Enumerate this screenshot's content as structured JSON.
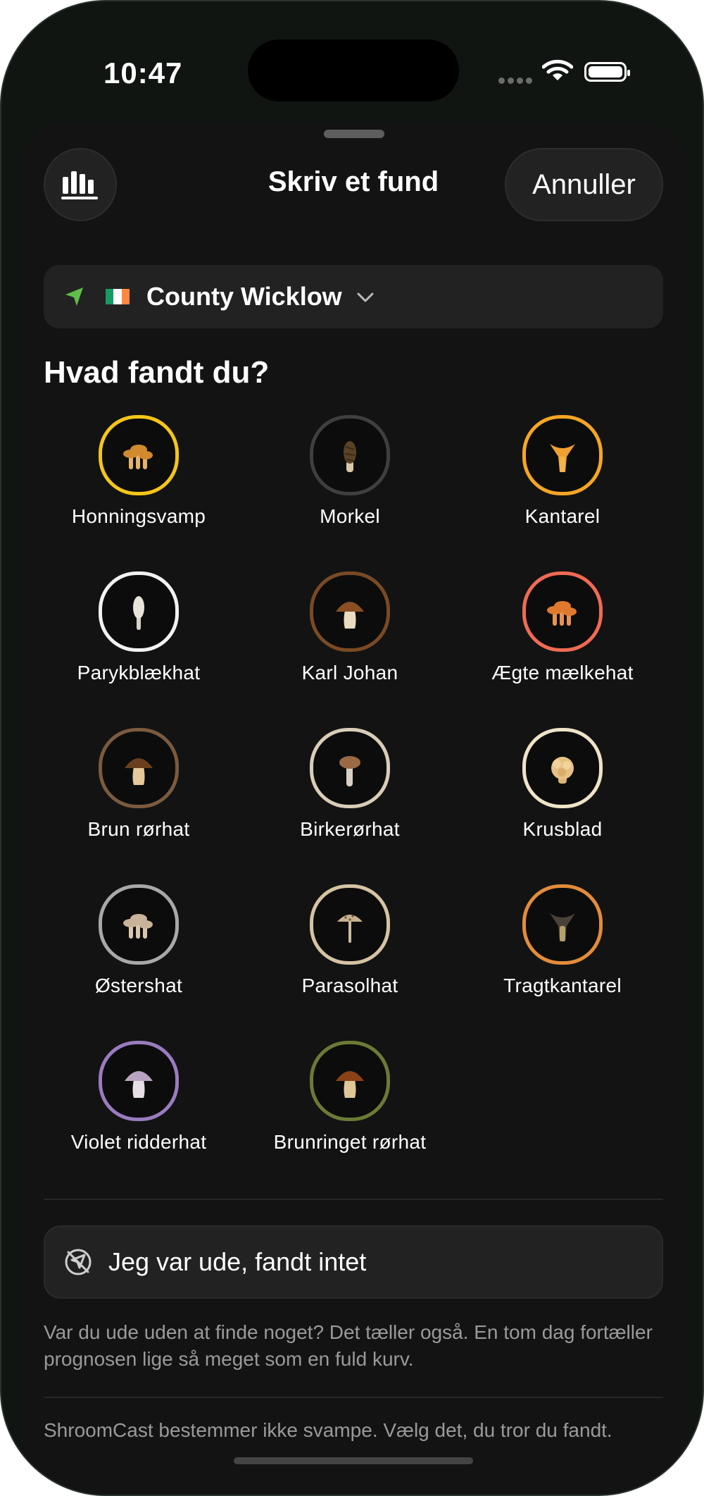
{
  "status_bar": {
    "time": "10:47"
  },
  "header": {
    "title": "Skriv et fund",
    "cancel_label": "Annuller",
    "stats_icon": "bar-chart-icon"
  },
  "location": {
    "name": "County Wicklow",
    "flag_colors": [
      "#169b62",
      "#ffffff",
      "#ff883e"
    ],
    "icon": "location-arrow-icon",
    "accent": "#5fbf4a"
  },
  "question": "Hvad fandt du?",
  "species": [
    {
      "label": "Honningsvamp",
      "ring": "#f5c518",
      "cap": "#d18a2e",
      "stem": "#e6b36a",
      "shape": "cluster"
    },
    {
      "label": "Morkel",
      "ring": "#3f3f3f",
      "cap": "#5b4226",
      "stem": "#d9c7a6",
      "shape": "morel"
    },
    {
      "label": "Kantarel",
      "ring": "#f5a623",
      "cap": "#f0a030",
      "stem": "#f3b54a",
      "shape": "funnel"
    },
    {
      "label": "Parykblækhat",
      "ring": "#f2f2f2",
      "cap": "#e8e4dc",
      "stem": "#d8d2c6",
      "shape": "tall"
    },
    {
      "label": "Karl Johan",
      "ring": "#7a4a24",
      "cap": "#8a4e22",
      "stem": "#e9dcc0",
      "shape": "bolete"
    },
    {
      "label": "Ægte mælkehat",
      "ring": "#f06a54",
      "cap": "#e0792e",
      "stem": "#e89350",
      "shape": "cluster"
    },
    {
      "label": "Brun rørhat",
      "ring": "#7b5a3e",
      "cap": "#6b3e1e",
      "stem": "#e7c89a",
      "shape": "bolete"
    },
    {
      "label": "Birkerørhat",
      "ring": "#d9cdb8",
      "cap": "#9a6a44",
      "stem": "#d8d0c4",
      "shape": "tallcap"
    },
    {
      "label": "Krusblad",
      "ring": "#efe3c8",
      "cap": "#e7c184",
      "stem": "#dcb676",
      "shape": "sponge"
    },
    {
      "label": "Østershat",
      "ring": "#a8a8a8",
      "cap": "#c9b49a",
      "stem": "#dac8ae",
      "shape": "cluster"
    },
    {
      "label": "Parasolhat",
      "ring": "#d6c3a3",
      "cap": "#c7b08e",
      "stem": "#cdbb9c",
      "shape": "parasol"
    },
    {
      "label": "Tragtkantarel",
      "ring": "#e38c3a",
      "cap": "#4a4238",
      "stem": "#b7a168",
      "shape": "funnel"
    },
    {
      "label": "Violet ridderhat",
      "ring": "#9a7bbf",
      "cap": "#b8a4c0",
      "stem": "#e7dfe6",
      "shape": "bolete"
    },
    {
      "label": "Brunringet rørhat",
      "ring": "#6b7a35",
      "cap": "#8a4216",
      "stem": "#e0c79a",
      "shape": "bolete"
    }
  ],
  "nothing_found": {
    "label": "Jeg var ude, fandt intet",
    "icon": "no-location-icon"
  },
  "info_text": "Var du ude uden at finde noget? Det tæller også. En tom dag fortæller prognosen lige så meget som en fuld kurv.",
  "disclaimer": "ShroomCast bestemmer ikke svampe. Vælg det, du tror du fandt."
}
